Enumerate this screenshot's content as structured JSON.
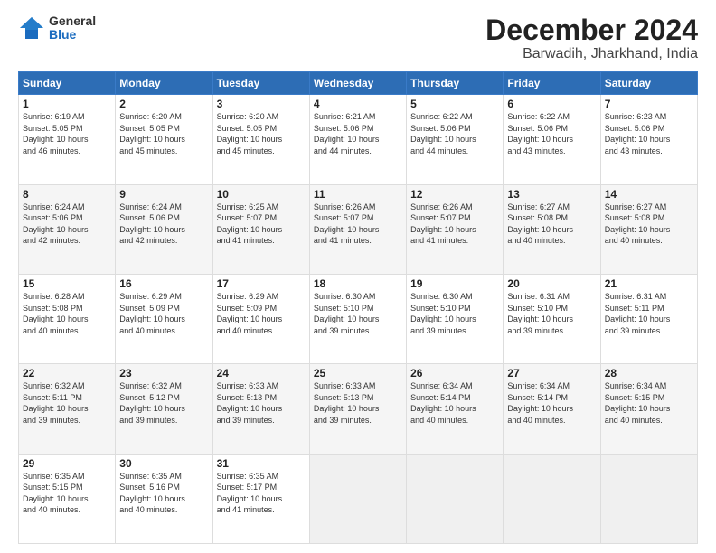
{
  "logo": {
    "general": "General",
    "blue": "Blue"
  },
  "header": {
    "month": "December 2024",
    "location": "Barwadih, Jharkhand, India"
  },
  "weekdays": [
    "Sunday",
    "Monday",
    "Tuesday",
    "Wednesday",
    "Thursday",
    "Friday",
    "Saturday"
  ],
  "weeks": [
    [
      {
        "day": "1",
        "info": "Sunrise: 6:19 AM\nSunset: 5:05 PM\nDaylight: 10 hours\nand 46 minutes."
      },
      {
        "day": "2",
        "info": "Sunrise: 6:20 AM\nSunset: 5:05 PM\nDaylight: 10 hours\nand 45 minutes."
      },
      {
        "day": "3",
        "info": "Sunrise: 6:20 AM\nSunset: 5:05 PM\nDaylight: 10 hours\nand 45 minutes."
      },
      {
        "day": "4",
        "info": "Sunrise: 6:21 AM\nSunset: 5:06 PM\nDaylight: 10 hours\nand 44 minutes."
      },
      {
        "day": "5",
        "info": "Sunrise: 6:22 AM\nSunset: 5:06 PM\nDaylight: 10 hours\nand 44 minutes."
      },
      {
        "day": "6",
        "info": "Sunrise: 6:22 AM\nSunset: 5:06 PM\nDaylight: 10 hours\nand 43 minutes."
      },
      {
        "day": "7",
        "info": "Sunrise: 6:23 AM\nSunset: 5:06 PM\nDaylight: 10 hours\nand 43 minutes."
      }
    ],
    [
      {
        "day": "8",
        "info": "Sunrise: 6:24 AM\nSunset: 5:06 PM\nDaylight: 10 hours\nand 42 minutes."
      },
      {
        "day": "9",
        "info": "Sunrise: 6:24 AM\nSunset: 5:06 PM\nDaylight: 10 hours\nand 42 minutes."
      },
      {
        "day": "10",
        "info": "Sunrise: 6:25 AM\nSunset: 5:07 PM\nDaylight: 10 hours\nand 41 minutes."
      },
      {
        "day": "11",
        "info": "Sunrise: 6:26 AM\nSunset: 5:07 PM\nDaylight: 10 hours\nand 41 minutes."
      },
      {
        "day": "12",
        "info": "Sunrise: 6:26 AM\nSunset: 5:07 PM\nDaylight: 10 hours\nand 41 minutes."
      },
      {
        "day": "13",
        "info": "Sunrise: 6:27 AM\nSunset: 5:08 PM\nDaylight: 10 hours\nand 40 minutes."
      },
      {
        "day": "14",
        "info": "Sunrise: 6:27 AM\nSunset: 5:08 PM\nDaylight: 10 hours\nand 40 minutes."
      }
    ],
    [
      {
        "day": "15",
        "info": "Sunrise: 6:28 AM\nSunset: 5:08 PM\nDaylight: 10 hours\nand 40 minutes."
      },
      {
        "day": "16",
        "info": "Sunrise: 6:29 AM\nSunset: 5:09 PM\nDaylight: 10 hours\nand 40 minutes."
      },
      {
        "day": "17",
        "info": "Sunrise: 6:29 AM\nSunset: 5:09 PM\nDaylight: 10 hours\nand 40 minutes."
      },
      {
        "day": "18",
        "info": "Sunrise: 6:30 AM\nSunset: 5:10 PM\nDaylight: 10 hours\nand 39 minutes."
      },
      {
        "day": "19",
        "info": "Sunrise: 6:30 AM\nSunset: 5:10 PM\nDaylight: 10 hours\nand 39 minutes."
      },
      {
        "day": "20",
        "info": "Sunrise: 6:31 AM\nSunset: 5:10 PM\nDaylight: 10 hours\nand 39 minutes."
      },
      {
        "day": "21",
        "info": "Sunrise: 6:31 AM\nSunset: 5:11 PM\nDaylight: 10 hours\nand 39 minutes."
      }
    ],
    [
      {
        "day": "22",
        "info": "Sunrise: 6:32 AM\nSunset: 5:11 PM\nDaylight: 10 hours\nand 39 minutes."
      },
      {
        "day": "23",
        "info": "Sunrise: 6:32 AM\nSunset: 5:12 PM\nDaylight: 10 hours\nand 39 minutes."
      },
      {
        "day": "24",
        "info": "Sunrise: 6:33 AM\nSunset: 5:13 PM\nDaylight: 10 hours\nand 39 minutes."
      },
      {
        "day": "25",
        "info": "Sunrise: 6:33 AM\nSunset: 5:13 PM\nDaylight: 10 hours\nand 39 minutes."
      },
      {
        "day": "26",
        "info": "Sunrise: 6:34 AM\nSunset: 5:14 PM\nDaylight: 10 hours\nand 40 minutes."
      },
      {
        "day": "27",
        "info": "Sunrise: 6:34 AM\nSunset: 5:14 PM\nDaylight: 10 hours\nand 40 minutes."
      },
      {
        "day": "28",
        "info": "Sunrise: 6:34 AM\nSunset: 5:15 PM\nDaylight: 10 hours\nand 40 minutes."
      }
    ],
    [
      {
        "day": "29",
        "info": "Sunrise: 6:35 AM\nSunset: 5:15 PM\nDaylight: 10 hours\nand 40 minutes."
      },
      {
        "day": "30",
        "info": "Sunrise: 6:35 AM\nSunset: 5:16 PM\nDaylight: 10 hours\nand 40 minutes."
      },
      {
        "day": "31",
        "info": "Sunrise: 6:35 AM\nSunset: 5:17 PM\nDaylight: 10 hours\nand 41 minutes."
      },
      {
        "day": "",
        "info": ""
      },
      {
        "day": "",
        "info": ""
      },
      {
        "day": "",
        "info": ""
      },
      {
        "day": "",
        "info": ""
      }
    ]
  ]
}
